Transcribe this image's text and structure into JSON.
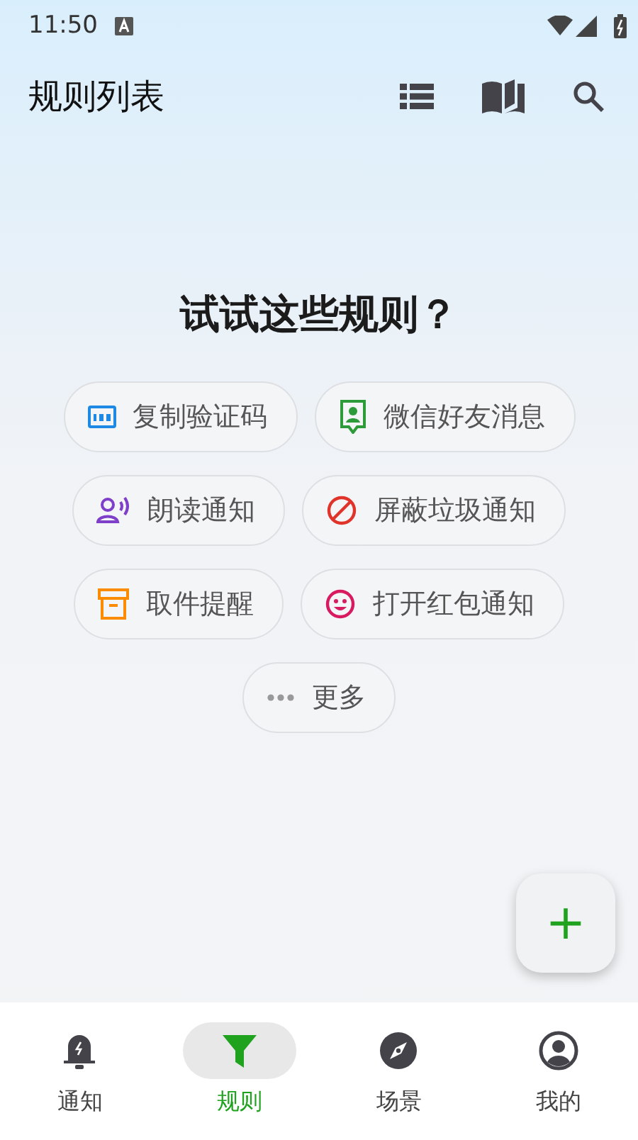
{
  "status_bar": {
    "time": "11:50"
  },
  "app_bar": {
    "title": "规则列表"
  },
  "heading": "试试这些规则？",
  "suggestion_rows": [
    [
      {
        "kind": "code",
        "label": "复制验证码"
      },
      {
        "kind": "contact",
        "label": "微信好友消息"
      }
    ],
    [
      {
        "kind": "voice",
        "label": "朗读通知"
      },
      {
        "kind": "block",
        "label": "屏蔽垃圾通知"
      }
    ],
    [
      {
        "kind": "box",
        "label": "取件提醒"
      },
      {
        "kind": "smile",
        "label": "打开红包通知"
      }
    ],
    [
      {
        "kind": "more",
        "label": "更多"
      }
    ]
  ],
  "fab": {
    "label": "+"
  },
  "nav": [
    {
      "kind": "bell",
      "label": "通知",
      "selected": false
    },
    {
      "kind": "filter",
      "label": "规则",
      "selected": true
    },
    {
      "kind": "compass",
      "label": "场景",
      "selected": false
    },
    {
      "kind": "person",
      "label": "我的",
      "selected": false
    }
  ]
}
